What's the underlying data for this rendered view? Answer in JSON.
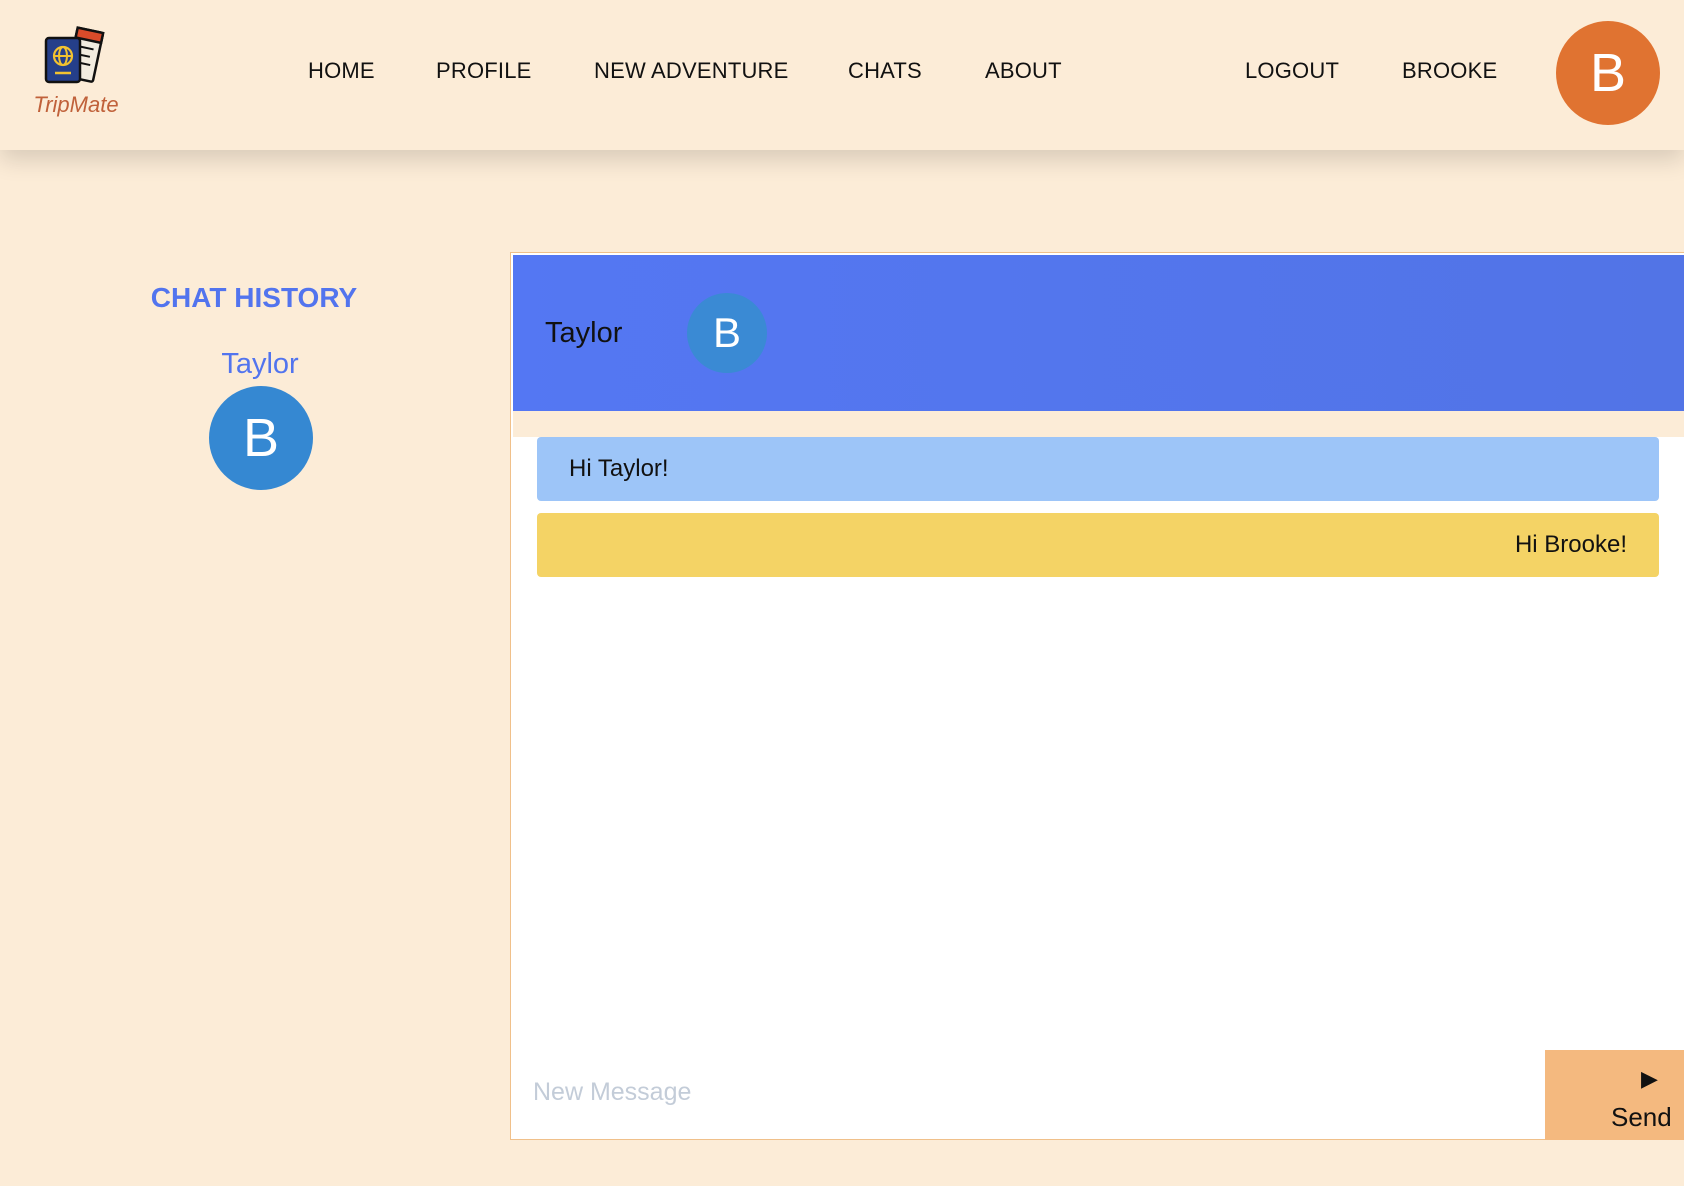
{
  "app": {
    "logo_text": "TripMate"
  },
  "nav": {
    "home": "HOME",
    "profile": "PROFILE",
    "new_adventure": "NEW ADVENTURE",
    "chats": "CHATS",
    "about": "ABOUT",
    "logout": "LOGOUT",
    "user": "BROOKE",
    "avatar_initial": "B"
  },
  "sidebar": {
    "title": "CHAT HISTORY",
    "items": [
      {
        "name": "Taylor",
        "avatar_initial": "B"
      }
    ]
  },
  "chat": {
    "header_name": "Taylor",
    "header_avatar_initial": "B",
    "messages": [
      {
        "text": "Hi Taylor!",
        "side": "incoming"
      },
      {
        "text": "Hi Brooke!",
        "side": "outgoing"
      }
    ],
    "input_placeholder": "New Message",
    "input_value": "",
    "send_icon": "play-triangle-icon",
    "send_label": "Send"
  },
  "colors": {
    "background": "#fcecd7",
    "accent_blue": "#5274ee",
    "avatar_orange": "#e07331",
    "avatar_blue": "#3588d2",
    "incoming_bubble": "#9dc5f8",
    "outgoing_bubble": "#f4d365",
    "send_button": "#f4b97f"
  }
}
